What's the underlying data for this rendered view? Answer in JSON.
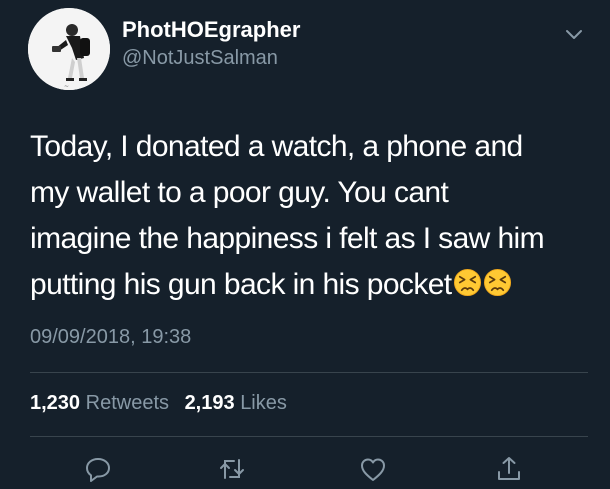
{
  "user": {
    "display_name": "PhotHOEgrapher",
    "handle": "@NotJustSalman"
  },
  "tweet": {
    "lines": [
      "Today, I donated a watch, a phone and",
      "my wallet to a poor guy. You cant",
      "imagine the happiness i felt as I saw him",
      "putting his gun back in his pocket"
    ],
    "emoji": [
      "persevering-face-emoji",
      "persevering-face-emoji"
    ],
    "timestamp": "09/09/2018, 19:38"
  },
  "stats": {
    "retweets_count": "1,230",
    "retweets_label": "Retweets",
    "likes_count": "2,193",
    "likes_label": "Likes"
  },
  "actions": [
    "reply-icon",
    "retweet-icon",
    "like-icon",
    "share-icon"
  ],
  "colors": {
    "background": "#15202b",
    "text": "#ffffff",
    "secondary": "#8899a6",
    "divider": "#38444d",
    "emoji": "#ffc933"
  }
}
